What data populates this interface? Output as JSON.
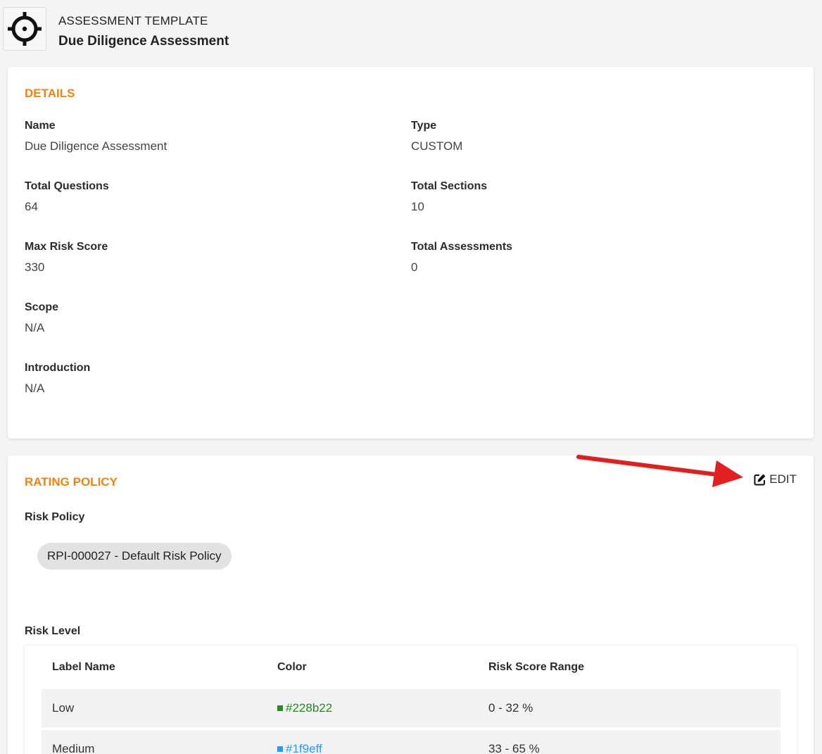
{
  "header": {
    "kicker": "ASSESSMENT TEMPLATE",
    "title": "Due Diligence Assessment",
    "icon": "crosshair-icon"
  },
  "details": {
    "section_title": "DETAILS",
    "fields": [
      {
        "label": "Name",
        "value": "Due Diligence Assessment"
      },
      {
        "label": "Type",
        "value": "CUSTOM"
      },
      {
        "label": "Total Questions",
        "value": "64"
      },
      {
        "label": "Total Sections",
        "value": "10"
      },
      {
        "label": "Max Risk Score",
        "value": "330"
      },
      {
        "label": "Total Assessments",
        "value": "0"
      },
      {
        "label": "Scope",
        "value": "N/A"
      },
      {
        "label": "Introduction",
        "value": "N/A"
      }
    ]
  },
  "rating_policy": {
    "section_title": "RATING POLICY",
    "edit_label": "EDIT",
    "edit_icon": "edit-icon",
    "risk_policy_label": "Risk Policy",
    "risk_policy_chip": "RPI-000027 - Default Risk Policy",
    "risk_level_label": "Risk Level",
    "table": {
      "headers": [
        "Label Name",
        "Color",
        "Risk Score Range"
      ],
      "rows": [
        {
          "label": "Low",
          "color": "#228b22",
          "range": "0 - 32 %"
        },
        {
          "label": "Medium",
          "color": "#1f9eff",
          "range": "33 - 65 %"
        }
      ]
    }
  },
  "annotation": {
    "arrow_color": "#e31e1e"
  }
}
